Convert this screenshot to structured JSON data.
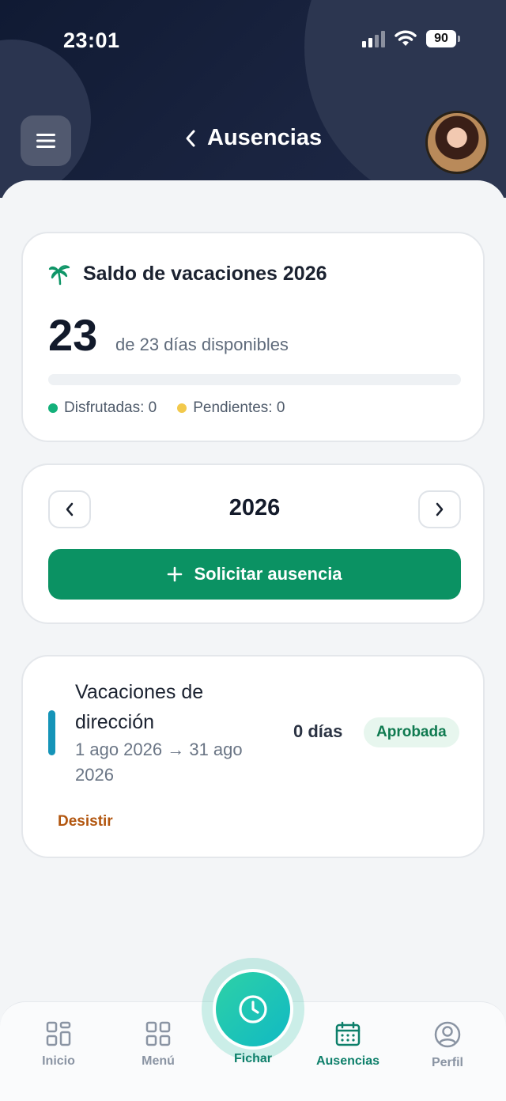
{
  "status_bar": {
    "time": "23:01",
    "battery": "90"
  },
  "header": {
    "title": "Ausencias"
  },
  "balance_card": {
    "title": "Saldo de vacaciones 2026",
    "available_days": "23",
    "subtitle": "de 23 días disponibles",
    "used_fraction": 0.0,
    "legend_enjoyed": "Disfrutadas: 0",
    "legend_pending": "Pendientes: 0"
  },
  "year_selector": {
    "year": "2026",
    "request_button": "Solicitar ausencia"
  },
  "absences": [
    {
      "title": "Vacaciones de dirección",
      "dates": "1 ago 2026 → 31 ago 2026",
      "days": "0 días",
      "status": "Aprobada",
      "action": "Desistir"
    }
  ],
  "bottom_nav": {
    "items": [
      {
        "label": "Inicio",
        "icon": "grid-icon"
      },
      {
        "label": "Menú",
        "icon": "grid-icon"
      },
      {
        "label": "Fichar",
        "icon": "clock-icon"
      },
      {
        "label": "Ausencias",
        "icon": "calendar-icon"
      },
      {
        "label": "Perfil",
        "icon": "user-circle-icon"
      }
    ],
    "active": "Ausencias"
  },
  "colors": {
    "header_bg": "#101a33",
    "primary_green": "#0b9263",
    "accent_teal": "#0d7f6a",
    "enjoyed_dot": "#13b07a",
    "pending_dot": "#f2c94c",
    "absence_accent": "#1594b8",
    "desist": "#b2560f"
  }
}
